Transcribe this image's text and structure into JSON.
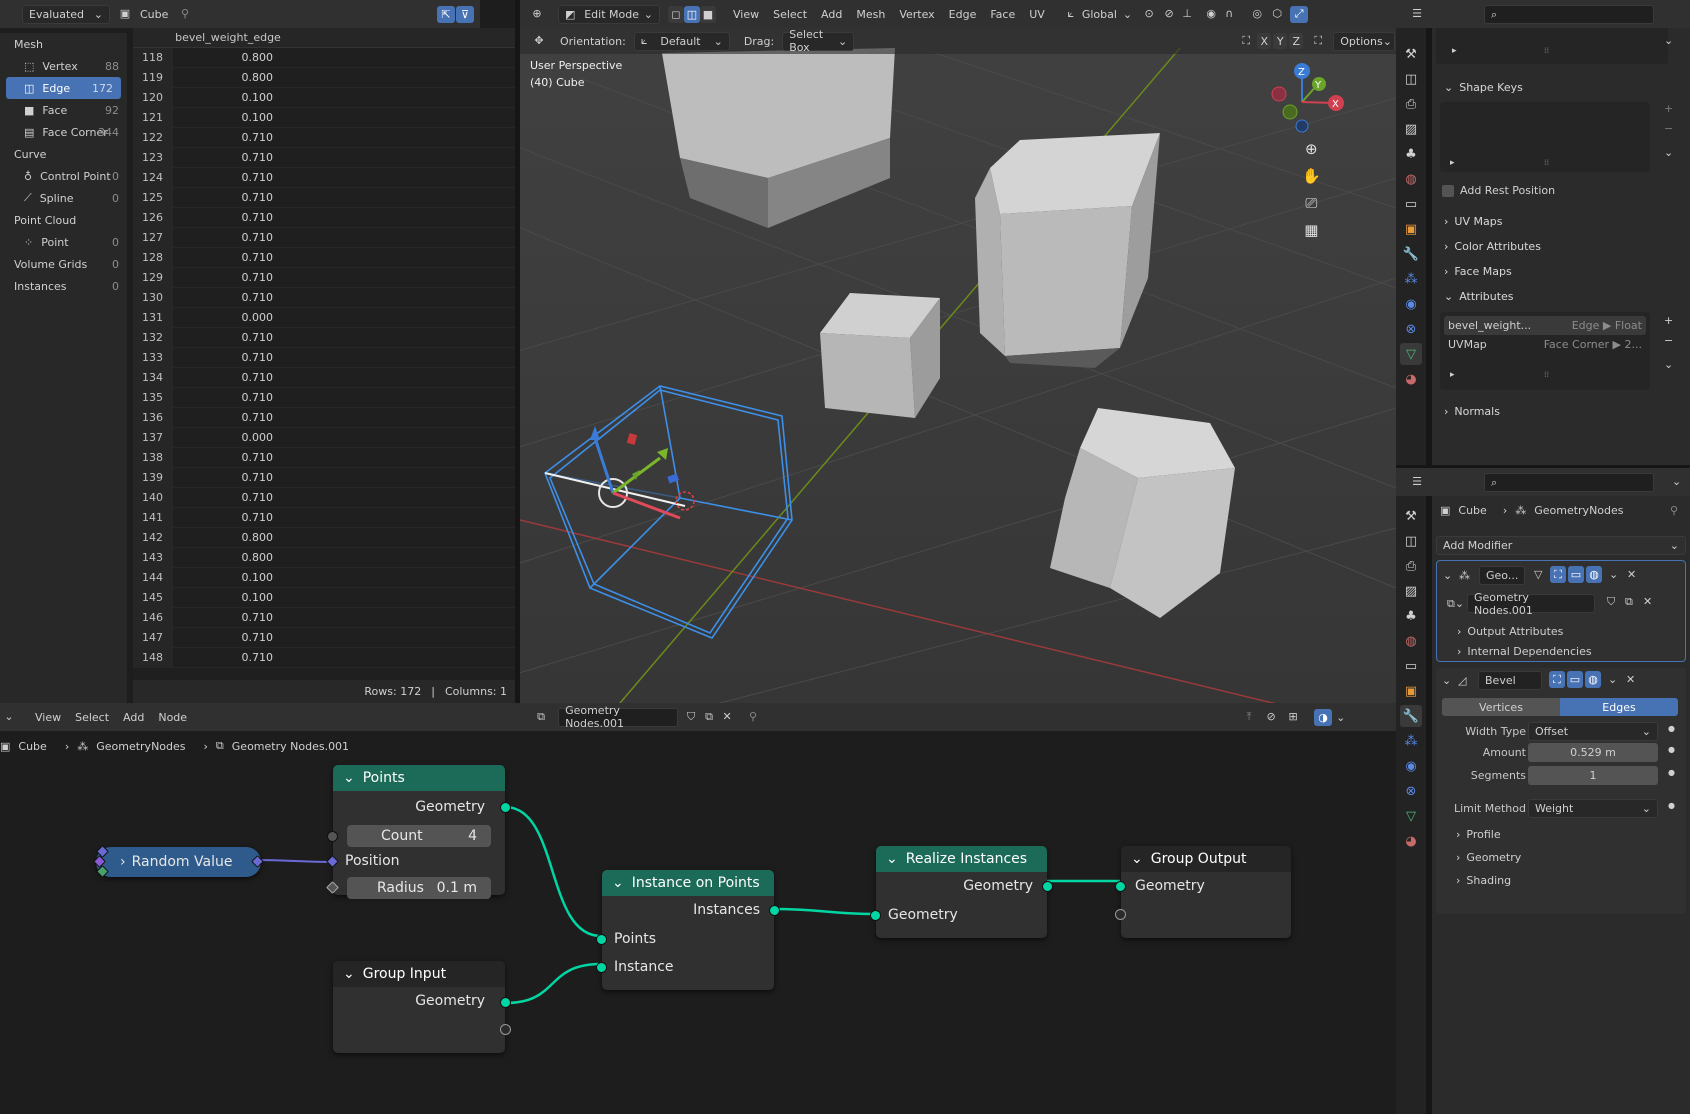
{
  "spreadsheet": {
    "header": {
      "mode": "Evaluated",
      "object": "Cube"
    },
    "domains": [
      {
        "label": "Mesh",
        "count": "",
        "type": "group"
      },
      {
        "label": "Vertex",
        "count": "88",
        "type": "item"
      },
      {
        "label": "Edge",
        "count": "172",
        "type": "item",
        "active": true
      },
      {
        "label": "Face",
        "count": "92",
        "type": "item"
      },
      {
        "label": "Face Corner",
        "count": "344",
        "type": "item"
      },
      {
        "label": "Curve",
        "count": "",
        "type": "group"
      },
      {
        "label": "Control Point",
        "count": "0",
        "type": "item"
      },
      {
        "label": "Spline",
        "count": "0",
        "type": "item"
      },
      {
        "label": "Point Cloud",
        "count": "",
        "type": "group"
      },
      {
        "label": "Point",
        "count": "0",
        "type": "item"
      },
      {
        "label": "Volume Grids",
        "count": "0",
        "type": "group"
      },
      {
        "label": "Instances",
        "count": "0",
        "type": "group"
      }
    ],
    "column_header": "bevel_weight_edge",
    "rows": [
      [
        "118",
        "0.800"
      ],
      [
        "119",
        "0.800"
      ],
      [
        "120",
        "0.100"
      ],
      [
        "121",
        "0.100"
      ],
      [
        "122",
        "0.710"
      ],
      [
        "123",
        "0.710"
      ],
      [
        "124",
        "0.710"
      ],
      [
        "125",
        "0.710"
      ],
      [
        "126",
        "0.710"
      ],
      [
        "127",
        "0.710"
      ],
      [
        "128",
        "0.710"
      ],
      [
        "129",
        "0.710"
      ],
      [
        "130",
        "0.710"
      ],
      [
        "131",
        "0.000"
      ],
      [
        "132",
        "0.710"
      ],
      [
        "133",
        "0.710"
      ],
      [
        "134",
        "0.710"
      ],
      [
        "135",
        "0.710"
      ],
      [
        "136",
        "0.710"
      ],
      [
        "137",
        "0.000"
      ],
      [
        "138",
        "0.710"
      ],
      [
        "139",
        "0.710"
      ],
      [
        "140",
        "0.710"
      ],
      [
        "141",
        "0.710"
      ],
      [
        "142",
        "0.800"
      ],
      [
        "143",
        "0.800"
      ],
      [
        "144",
        "0.100"
      ],
      [
        "145",
        "0.100"
      ],
      [
        "146",
        "0.710"
      ],
      [
        "147",
        "0.710"
      ],
      [
        "148",
        "0.710"
      ]
    ],
    "footer": {
      "rows": "Rows: 172",
      "sep": "|",
      "columns": "Columns: 1"
    }
  },
  "viewport": {
    "mode": "Edit Mode",
    "menus": [
      "View",
      "Select",
      "Add",
      "Mesh",
      "Vertex",
      "Edge",
      "Face",
      "UV"
    ],
    "transform_orientation": "Global",
    "orientation_label": "Orientation:",
    "orientation_value": "Default",
    "drag_label": "Drag:",
    "drag_value": "Select Box",
    "options": "Options",
    "axes": [
      "X",
      "Y",
      "Z"
    ],
    "overlay_line1": "User Perspective",
    "overlay_line2": "(40) Cube",
    "gizmo": {
      "x": "X",
      "y": "Y",
      "z": "Z"
    }
  },
  "node_editor": {
    "menus": [
      "View",
      "Select",
      "Add",
      "Node"
    ],
    "tree_name": "Geometry Nodes.001",
    "breadcrumb": [
      "Cube",
      "GeometryNodes",
      "Geometry Nodes.001"
    ],
    "nodes": {
      "points": {
        "title": "Points",
        "out_geometry": "Geometry",
        "count_label": "Count",
        "count_value": "4",
        "position": "Position",
        "radius_label": "Radius",
        "radius_value": "0.1 m"
      },
      "random_value": {
        "title": "Random Value"
      },
      "instance_on_points": {
        "title": "Instance on Points",
        "out_instances": "Instances",
        "in_points": "Points",
        "in_instance": "Instance"
      },
      "realize_instances": {
        "title": "Realize Instances",
        "out_geometry": "Geometry",
        "in_geometry": "Geometry"
      },
      "group_output": {
        "title": "Group Output",
        "in_geometry": "Geometry"
      },
      "group_input": {
        "title": "Group Input",
        "out_geometry": "Geometry"
      }
    }
  },
  "data_props": {
    "shape_keys": "Shape Keys",
    "add_rest_position": "Add Rest Position",
    "uv_maps": "UV Maps",
    "color_attributes": "Color Attributes",
    "face_maps": "Face Maps",
    "attributes": "Attributes",
    "attribute_list": [
      {
        "name": "bevel_weight...",
        "domain": "Edge ▶ Float"
      },
      {
        "name": "UVMap",
        "domain": "Face Corner ▶ 2..."
      }
    ],
    "normals": "Normals"
  },
  "modifier_props": {
    "breadcrumb": [
      "Cube",
      "GeometryNodes"
    ],
    "add_modifier": "Add Modifier",
    "geo_modifier": {
      "name": "Geo...",
      "node_group": "Geometry Nodes.001",
      "output_attributes": "Output Attributes",
      "internal_dependencies": "Internal Dependencies"
    },
    "bevel": {
      "name": "Bevel",
      "tabs": [
        "Vertices",
        "Edges"
      ],
      "width_type_label": "Width Type",
      "width_type": "Offset",
      "amount_label": "Amount",
      "amount": "0.529 m",
      "segments_label": "Segments",
      "segments": "1",
      "limit_method_label": "Limit Method",
      "limit_method": "Weight",
      "profile": "Profile",
      "geometry": "Geometry",
      "shading": "Shading"
    }
  },
  "colors": {
    "accent": "#4772b3",
    "node_header": "#1c6a58",
    "geometry_socket": "#00d6a3",
    "selection_outline": "#3d8fe8"
  }
}
